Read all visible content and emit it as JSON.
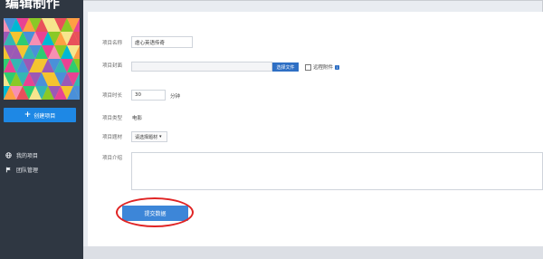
{
  "app": {
    "brand": "编辑制作"
  },
  "sidebar": {
    "create_label": "创建项目",
    "items": [
      {
        "label": "我的项目",
        "icon": "globe-icon"
      },
      {
        "label": "团队管理",
        "icon": "flag-icon"
      }
    ]
  },
  "form": {
    "name_label": "项目名称",
    "name_value": "虐心英语传奇",
    "cover_label": "项目封面",
    "upload_label": "选择文件",
    "remote_label": "远程附件",
    "duration_label": "项目时长",
    "duration_value": "30",
    "duration_unit": "分钟",
    "type_label": "项目类型",
    "type_value": "电影",
    "theme_label": "项目题材",
    "theme_value": "请选择题材",
    "intro_label": "项目介绍",
    "submit_label": "提交数据"
  },
  "colors": {
    "accent": "#1e88e5",
    "sidebar": "#2f3742",
    "highlight": "#e02424"
  }
}
